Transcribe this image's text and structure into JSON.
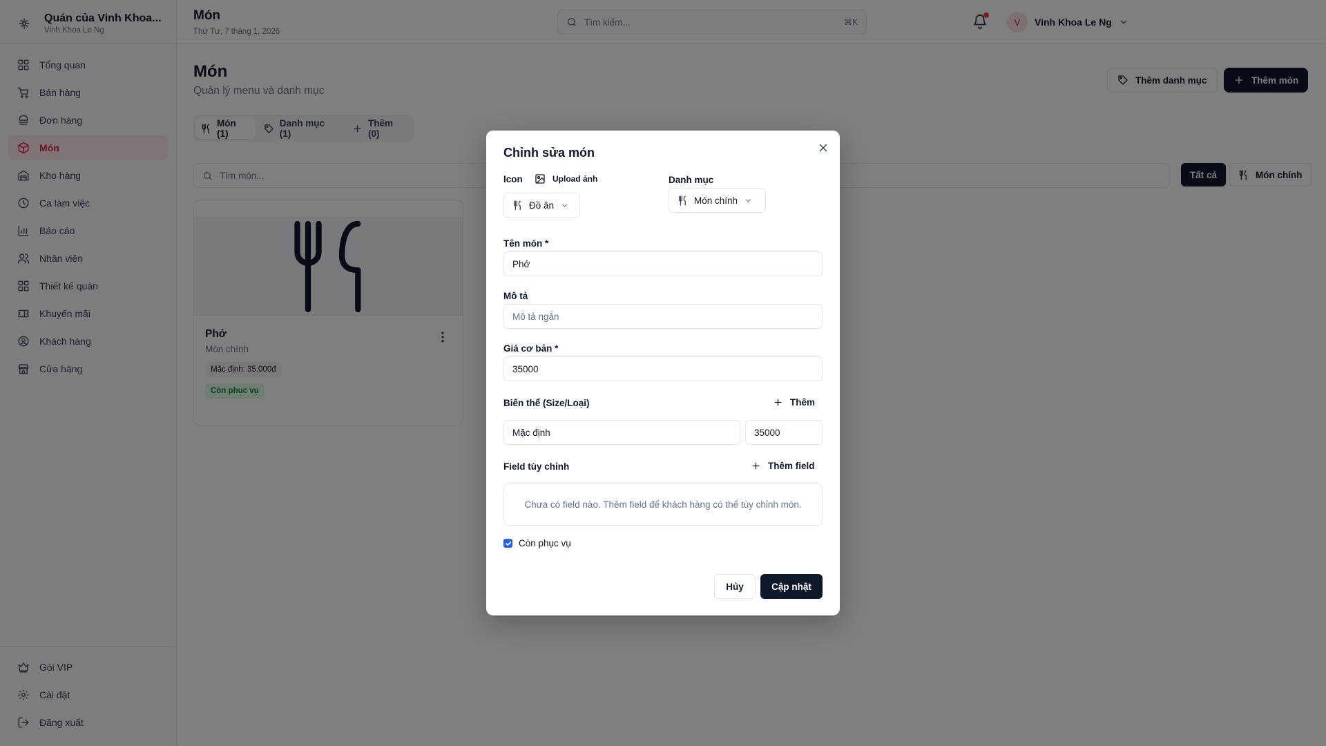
{
  "brand": {
    "title": "Quán của Vinh Khoa...",
    "subtitle": "Vinh Khoa Le Ng"
  },
  "sidebar": {
    "items": [
      {
        "label": "Tổng quan",
        "icon": "dashboard-icon"
      },
      {
        "label": "Bán hàng",
        "icon": "cart-icon"
      },
      {
        "label": "Đơn hàng",
        "icon": "orders-icon"
      },
      {
        "label": "Món",
        "icon": "package-icon",
        "active": true
      },
      {
        "label": "Kho hàng",
        "icon": "warehouse-icon"
      },
      {
        "label": "Ca làm việc",
        "icon": "clock-icon"
      },
      {
        "label": "Báo cáo",
        "icon": "chart-icon"
      },
      {
        "label": "Nhân viên",
        "icon": "users-icon"
      },
      {
        "label": "Thiết kế quán",
        "icon": "layout-icon"
      },
      {
        "label": "Khuyến mãi",
        "icon": "ticket-icon"
      },
      {
        "label": "Khách hàng",
        "icon": "user-circle-icon"
      },
      {
        "label": "Cửa hàng",
        "icon": "store-icon"
      }
    ],
    "bottom": [
      {
        "label": "Gói VIP",
        "icon": "crown-icon"
      },
      {
        "label": "Cài đặt",
        "icon": "gear-icon"
      },
      {
        "label": "Đăng xuất",
        "icon": "logout-icon"
      }
    ]
  },
  "header": {
    "title": "Món",
    "date": "Thứ Tư, 7 tháng 1, 2026",
    "search_placeholder": "Tìm kiếm...",
    "shortcut": "⌘K",
    "user_initial": "V",
    "user_name": "Vinh Khoa Le Ng"
  },
  "main": {
    "title": "Món",
    "subtitle": "Quản lý menu và danh mục",
    "add_category_label": "Thêm danh mục",
    "add_item_label": "Thêm món",
    "tabs": [
      {
        "label": "Món (1)",
        "active": true
      },
      {
        "label": "Danh mục (1)"
      },
      {
        "label": "Thêm (0)"
      }
    ],
    "search_placeholder": "Tìm món...",
    "filters": {
      "all": "Tất cả",
      "category": "Món chính"
    },
    "card": {
      "name": "Phở",
      "category": "Món chính",
      "price_badge": "Mặc định: 35.000đ",
      "status": "Còn phục vụ"
    }
  },
  "modal": {
    "title": "Chỉnh sửa món",
    "icon_label": "Icon",
    "upload_label": "Upload ảnh",
    "icon_select": "Đồ ăn",
    "category_label": "Danh mục",
    "category_select": "Món chính",
    "name_label": "Tên món *",
    "name_value": "Phở",
    "desc_label": "Mô tả",
    "desc_placeholder": "Mô tả ngắn",
    "price_label": "Giá cơ bản *",
    "price_value": "35000",
    "variants_label": "Biến thể (Size/Loại)",
    "variants_add": "Thêm",
    "variant_name": "Mặc định",
    "variant_price": "35000",
    "custom_label": "Field tùy chỉnh",
    "custom_add": "Thêm field",
    "custom_empty": "Chưa có field nào. Thêm field để khách hàng có thể tùy chỉnh món.",
    "available_label": "Còn phục vụ",
    "available_checked": true,
    "cancel_label": "Hủy",
    "save_label": "Cập nhật"
  }
}
